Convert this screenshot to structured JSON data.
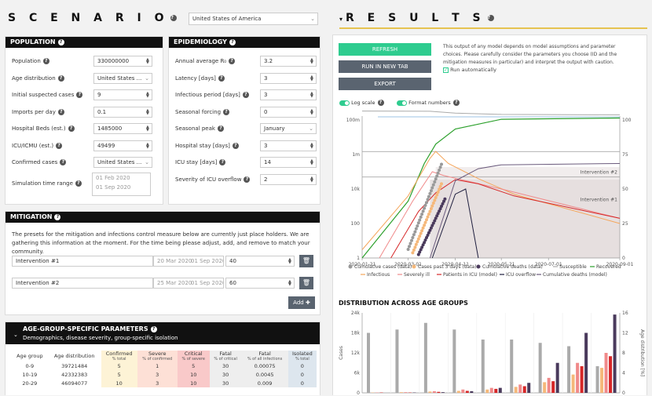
{
  "scenario": {
    "title": "S C E N A R I O",
    "country": "United States of America"
  },
  "results": {
    "title": "R E S U L T S",
    "refresh": "REFRESH",
    "run_new_tab": "RUN IN NEW TAB",
    "export": "EXPORT",
    "note": "This output of any model depends on model assumptions and parameter choices. Please carefully consider the parameters you choose (ID and the mitigation measures in particular) and interpret the output with caution.",
    "run_auto": "Run automatically",
    "log_scale": "Log scale",
    "format_numbers": "Format numbers",
    "distribution_title": "DISTRIBUTION ACROSS AGE GROUPS"
  },
  "population": {
    "title": "POPULATION",
    "fields": [
      {
        "label": "Population",
        "value": "330000000",
        "kind": "num"
      },
      {
        "label": "Age distribution",
        "value": "United States ...",
        "kind": "select"
      },
      {
        "label": "Initial suspected cases",
        "value": "9",
        "kind": "num"
      },
      {
        "label": "Imports per day",
        "value": "0.1",
        "kind": "num"
      },
      {
        "label": "Hospital Beds (est.)",
        "value": "1485000",
        "kind": "num"
      },
      {
        "label": "ICU/ICMU (est.)",
        "value": "49499",
        "kind": "num"
      },
      {
        "label": "Confirmed cases",
        "value": "United States ...",
        "kind": "select"
      }
    ],
    "sim_label": "Simulation time range",
    "sim_start": "01 Feb 2020",
    "sim_end": "01 Sep 2020"
  },
  "epidemiology": {
    "title": "EPIDEMIOLOGY",
    "fields": [
      {
        "label": "Annual average R₀",
        "value": "3.2",
        "kind": "num"
      },
      {
        "label": "Latency [days]",
        "value": "3",
        "kind": "num"
      },
      {
        "label": "Infectious period [days]",
        "value": "3",
        "kind": "num"
      },
      {
        "label": "Seasonal forcing",
        "value": "0",
        "kind": "num"
      },
      {
        "label": "Seasonal peak",
        "value": "January",
        "kind": "select"
      },
      {
        "label": "Hospital stay [days]",
        "value": "3",
        "kind": "num"
      },
      {
        "label": "ICU stay [days]",
        "value": "14",
        "kind": "num"
      },
      {
        "label": "Severity of ICU overflow",
        "value": "2",
        "kind": "num"
      }
    ]
  },
  "mitigation": {
    "title": "MITIGATION",
    "text": "The presets for the mitigation and infections control measure below are currently just place holders. We are gathering this information at the moment. For the time being please adjust, add, and remove to match your community.",
    "interventions": [
      {
        "name": "Intervention #1",
        "start": "20 Mar 2020",
        "end": "01 Sep 2020",
        "value": "40"
      },
      {
        "name": "Intervention #2",
        "start": "25 Mar 2020",
        "end": "01 Sep 2020",
        "value": "60"
      }
    ],
    "add": "Add"
  },
  "agegroups": {
    "title": "AGE-GROUP-SPECIFIC PARAMETERS",
    "subtitle": "Demographics, disease severity, group-specific isolation",
    "headers": [
      {
        "t": "Age group",
        "s": ""
      },
      {
        "t": "Age distribution",
        "s": ""
      },
      {
        "t": "Confirmed",
        "s": "% total"
      },
      {
        "t": "Severe",
        "s": "% of confirmed"
      },
      {
        "t": "Critical",
        "s": "% of severe"
      },
      {
        "t": "Fatal",
        "s": "% of critical"
      },
      {
        "t": "Fatal",
        "s": "% of all infections"
      },
      {
        "t": "Isolated",
        "s": "% total"
      }
    ],
    "rows": [
      [
        "0-9",
        "39721484",
        "5",
        "1",
        "5",
        "30",
        "0.00075",
        "0"
      ],
      [
        "10-19",
        "42332383",
        "5",
        "3",
        "10",
        "30",
        "0.0045",
        "0"
      ],
      [
        "20-29",
        "46094077",
        "10",
        "3",
        "10",
        "30",
        "0.009",
        "0"
      ]
    ]
  },
  "chart_data": [
    {
      "type": "line",
      "log_scale": true,
      "x_ticks": [
        "2020-01-21",
        "2020-03-01",
        "2020-04-11",
        "2020-05-21",
        "2020-07-01",
        "2020-09-01"
      ],
      "y_ticks": [
        "100m",
        "1m",
        "10k",
        "100",
        "1"
      ],
      "y2_ticks": [
        "100",
        "75",
        "50",
        "25",
        "0"
      ],
      "annotations": [
        "Intervention #2",
        "Intervention #1"
      ],
      "legend": [
        {
          "name": "Cumulative cases (data)",
          "color": "#999999",
          "style": "dot"
        },
        {
          "name": "Cases past 3 days (data)",
          "color": "#f5b87a",
          "style": "dot"
        },
        {
          "name": "Cumulative deaths (data)",
          "color": "#4a3a5c",
          "style": "dot"
        },
        {
          "name": "Susceptible",
          "color": "#aaaaaa",
          "style": "line"
        },
        {
          "name": "Recovered",
          "color": "#2ca02c",
          "style": "line"
        },
        {
          "name": "Infectious",
          "color": "#f5a65b",
          "style": "line"
        },
        {
          "name": "Severely ill",
          "color": "#f08a8a",
          "style": "line"
        },
        {
          "name": "Patients in ICU (model)",
          "color": "#d62728",
          "style": "line"
        },
        {
          "name": "ICU overflow",
          "color": "#1f1f3f",
          "style": "line"
        },
        {
          "name": "Cumulative deaths (model)",
          "color": "#6a5a7c",
          "style": "line"
        }
      ]
    },
    {
      "type": "bar",
      "title": "DISTRIBUTION ACROSS AGE GROUPS",
      "ylabel": "Cases",
      "y2label": "Age distribution [%]",
      "y_ticks": [
        "24k",
        "18k",
        "12k",
        "6k",
        "0"
      ],
      "y2_ticks": [
        "16",
        "12",
        "8",
        "4",
        "0"
      ],
      "groups": 9,
      "series": [
        {
          "color": "#aaaaaa",
          "values": [
            18,
            19,
            21,
            19,
            16,
            16,
            15,
            14,
            8
          ]
        },
        {
          "color": "#f5b87a",
          "values": [
            0.1,
            0.2,
            0.4,
            0.6,
            1.0,
            1.8,
            3.2,
            5.5,
            7.5
          ]
        },
        {
          "color": "#f08a8a",
          "values": [
            0.1,
            0.2,
            0.5,
            1.0,
            1.5,
            2.5,
            4.5,
            9.0,
            12.0
          ]
        },
        {
          "color": "#d62728",
          "values": [
            0.1,
            0.1,
            0.3,
            0.6,
            1.2,
            2.0,
            3.5,
            8.0,
            11.0
          ]
        },
        {
          "color": "#4a3a5c",
          "values": [
            0.0,
            0.1,
            0.2,
            0.5,
            1.5,
            3.0,
            9.0,
            18.0,
            23.5
          ]
        }
      ]
    }
  ]
}
